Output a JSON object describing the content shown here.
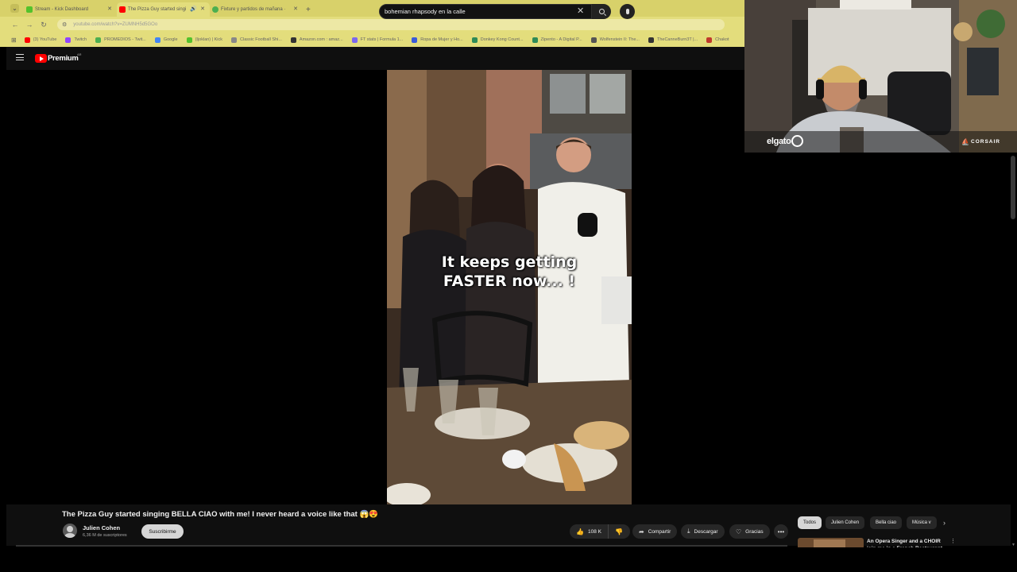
{
  "browser": {
    "tabs": [
      {
        "title": "Stream - Kick Dashboard",
        "favicon_color": "#53c22b",
        "active": false
      },
      {
        "title": "The Pizza Guy started singi",
        "favicon_color": "#ff0000",
        "active": true
      },
      {
        "title": "Fixture y partidos de mañana ·",
        "favicon_color": "#4caf50",
        "active": false
      }
    ],
    "new_tab_label": "+",
    "url": "youtube.com/watch?v=ZUMNH5d5GOo",
    "bookmarks": [
      {
        "label": "(3) YouTube",
        "color": "#ff0000"
      },
      {
        "label": "Twitch",
        "color": "#9146ff"
      },
      {
        "label": "PROMEDIOS - Twit...",
        "color": "#4caf50"
      },
      {
        "label": "Google",
        "color": "#4285f4"
      },
      {
        "label": "(Ijoklan) | Kick",
        "color": "#53c22b"
      },
      {
        "label": "Classic Football Shi...",
        "color": "#888888"
      },
      {
        "label": "Amazon.com : amaz...",
        "color": "#333333"
      },
      {
        "label": "FT stats | Formula 1...",
        "color": "#7b68ee"
      },
      {
        "label": "Ropa de Mujer y Ho...",
        "color": "#3a5bd9"
      },
      {
        "label": "Donkey Kong Count...",
        "color": "#2e8b57"
      },
      {
        "label": "Zipento - A Digital P...",
        "color": "#2e8b57"
      },
      {
        "label": "Wolfenstein II: The...",
        "color": "#555555"
      },
      {
        "label": "TheCanneBurn3T |...",
        "color": "#333333"
      },
      {
        "label": "Chakot",
        "color": "#c0392b"
      }
    ]
  },
  "youtube": {
    "brand": "Premium",
    "region": "AR",
    "search_query": "bohemian rhapsody en la calle",
    "video_caption_line1": "It keeps getting",
    "video_caption_line2": "FASTER now... !",
    "title": "The Pizza Guy started singing BELLA CIAO with me! I never heard a voice like that 😱😍",
    "channel": "Julien Cohen",
    "subscribers": "6,36 M de suscriptores",
    "subscribe_label": "Suscribirme",
    "likes": "108 K",
    "share_label": "Compartir",
    "download_label": "Descargar",
    "thanks_label": "Gracias",
    "chips": [
      {
        "label": "Todos",
        "active": true
      },
      {
        "label": "Julien Cohen",
        "active": false
      },
      {
        "label": "Bella ciao",
        "active": false
      },
      {
        "label": "Música v",
        "active": false
      }
    ],
    "recommendation_title": "An Opera Singer and a CHOIR join me in a French Restaurant"
  },
  "overlay": {
    "elgato": "elgato",
    "corsair": "CORSAIR"
  },
  "colors": {
    "browser_chrome": "#e3dd7c",
    "yt_background": "#0f0f0f",
    "yt_red": "#ff0000"
  }
}
